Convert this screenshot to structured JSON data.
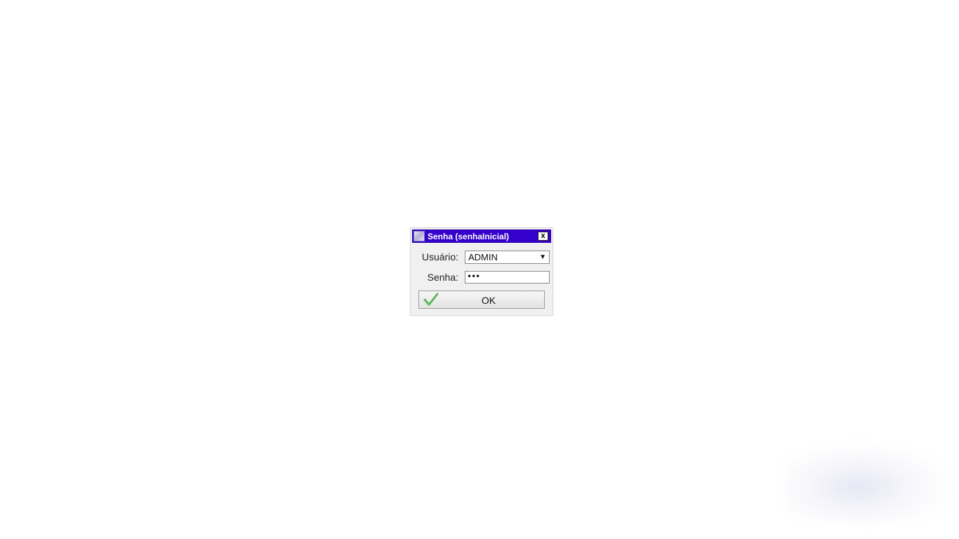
{
  "dialog": {
    "title": "Senha (senhaInicial)",
    "close_label": "x",
    "user_label": "Usuário:",
    "user_value": "ADMIN",
    "password_label": "Senha:",
    "password_value": "•••",
    "ok_label": "OK"
  },
  "colors": {
    "titlebar": "#3300cc",
    "ok_check": "#5cb85c"
  },
  "icons": {
    "window_icon": "window-icon",
    "dropdown_arrow": "chevron-down-icon",
    "ok_icon": "checkmark-icon"
  }
}
